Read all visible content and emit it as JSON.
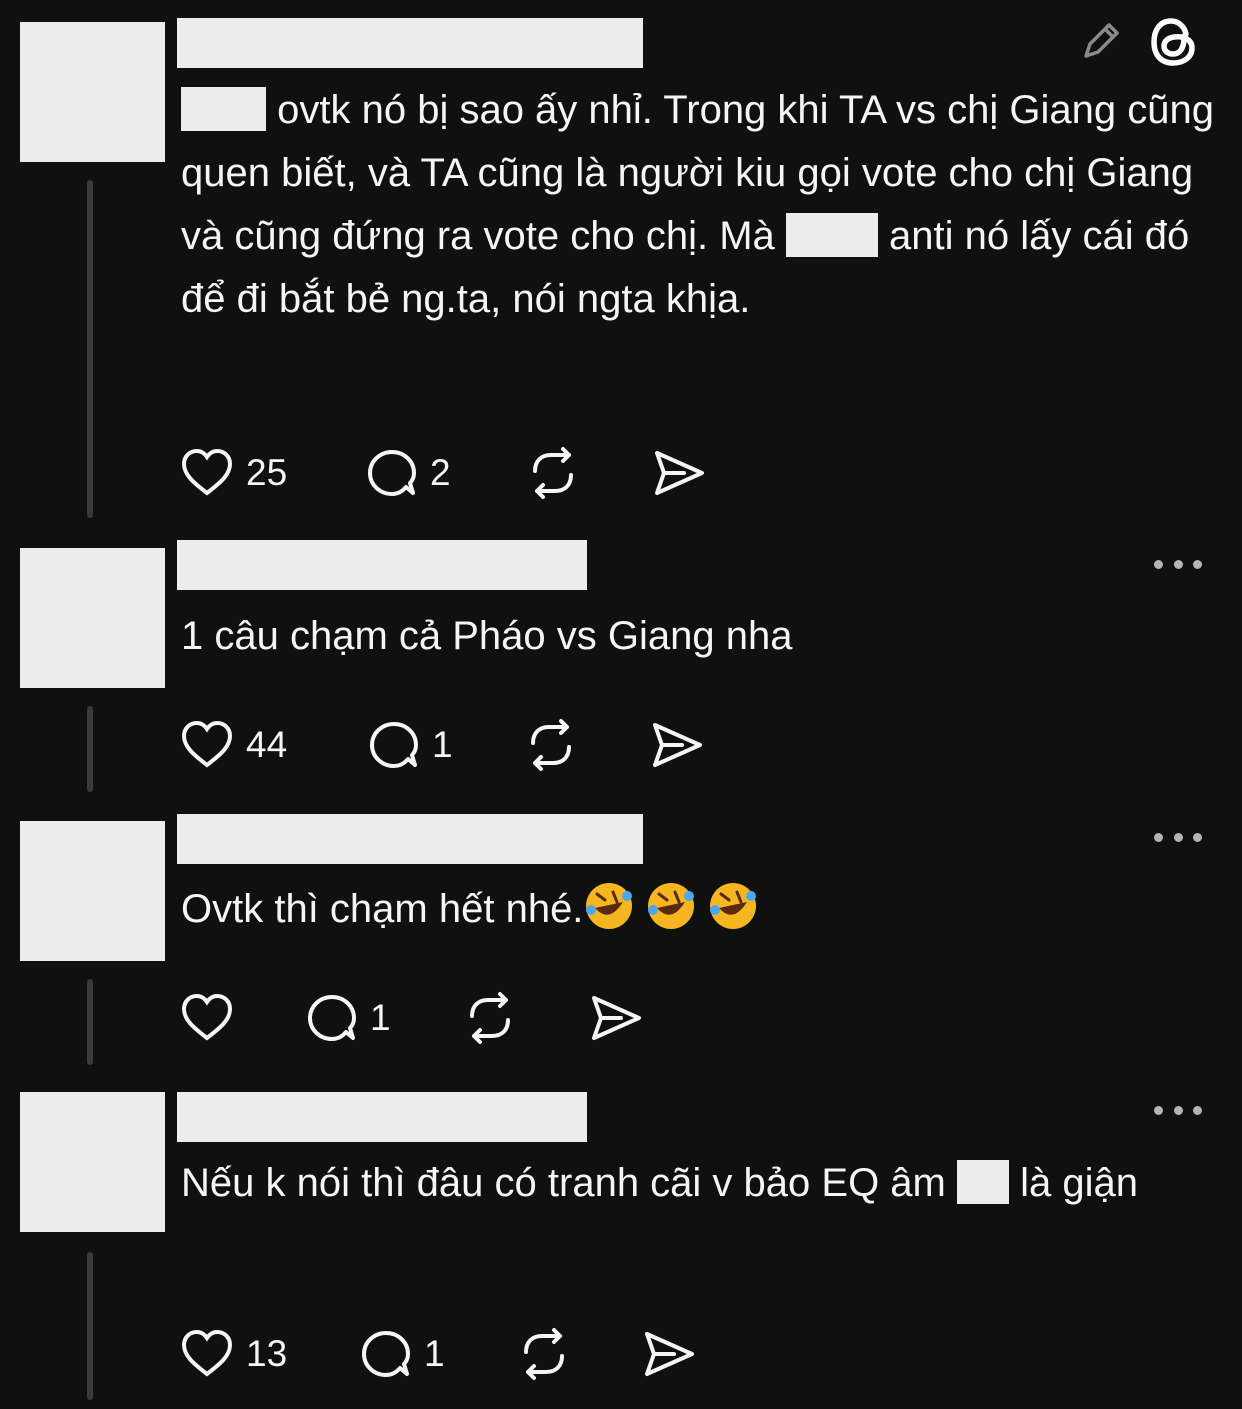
{
  "header": {
    "edit_icon": "pencil-icon",
    "logo_icon": "threads-logo-icon"
  },
  "posts": [
    {
      "text_parts": [
        "ovtk nó bị sao ấy nhỉ. Trong khi TA vs chị Giang cũng quen biết, và TA cũng là người kiu gọi vote cho chị Giang và cũng đứng ra vote cho chị. Mà",
        "anti nó lấy cái đó để đi bắt bẻ ng.ta, nói ngta khịa."
      ],
      "likes": "25",
      "replies": "2"
    },
    {
      "text": "1 câu chạm cả Pháo vs Giang nha",
      "likes": "44",
      "replies": "1"
    },
    {
      "text": "Ovtk thì chạm hết nhé.",
      "emoji": [
        "rolling-on-floor-laughing",
        "rolling-on-floor-laughing",
        "rolling-on-floor-laughing"
      ],
      "likes": "",
      "replies": "1"
    },
    {
      "text_parts": [
        "Nếu k nói thì đâu có tranh cãi v bảo EQ âm",
        "là giận"
      ],
      "likes": "13",
      "replies": "1"
    }
  ],
  "icons": {
    "like": "heart-icon",
    "reply": "comment-icon",
    "repost": "repost-icon",
    "share": "send-icon",
    "more": "more-dots-icon"
  },
  "colors": {
    "background": "#101010",
    "text": "#f3f5f7",
    "redaction": "#ececec",
    "thread_line": "#3a3a3a"
  }
}
